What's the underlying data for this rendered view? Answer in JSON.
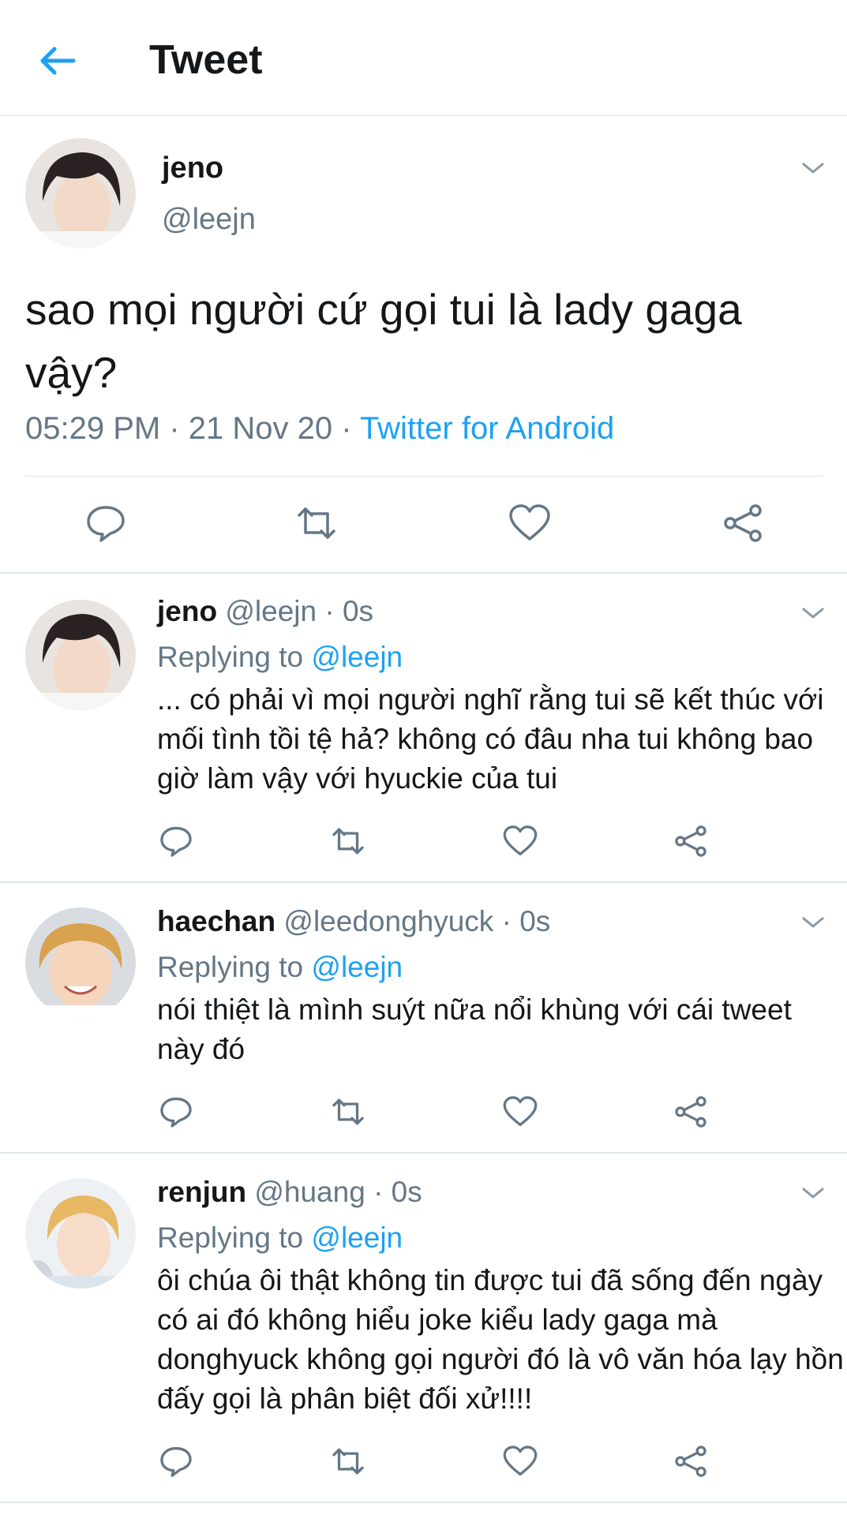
{
  "header": {
    "title": "Tweet"
  },
  "main_tweet": {
    "name": "jeno",
    "handle": "@leejn",
    "text": "sao mọi người cứ gọi tui là lady gaga vậy?",
    "time": "05:29 PM · 21 Nov 20 · ",
    "source": "Twitter for Android"
  },
  "replies": [
    {
      "name": "jeno",
      "handle": "@leejn · 0s",
      "replying_prefix": "Replying to ",
      "replying_to": "@leejn",
      "text": "... có phải vì mọi người nghĩ rằng tui sẽ kết thúc với mối tình tồi tệ hả? không có đâu nha tui không bao giờ làm vậy với hyuckie của tui"
    },
    {
      "name": "haechan",
      "handle": "@leedonghyuck · 0s",
      "replying_prefix": "Replying to ",
      "replying_to": "@leejn",
      "text": "nói thiệt là mình suýt nữa nổi khùng với cái tweet này đó"
    },
    {
      "name": "renjun",
      "handle": "@huang · 0s",
      "replying_prefix": "Replying to ",
      "replying_to": "@leejn",
      "text": "ôi chúa ôi thật không tin được tui đã sống đến ngày có ai đó không hiểu joke kiểu lady gaga mà donghyuck không gọi người đó là vô văn hóa lạy hồn đấy gọi là phân biệt đối xử!!!!"
    }
  ],
  "icons": {
    "back": "arrow-left-icon",
    "reply": "reply-icon",
    "retweet": "retweet-icon",
    "like": "heart-icon",
    "share": "share-icon",
    "caret": "chevron-down-icon"
  },
  "colors": {
    "accent": "#1da1f2",
    "secondary_text": "#657786",
    "icon_gray": "#657786"
  }
}
